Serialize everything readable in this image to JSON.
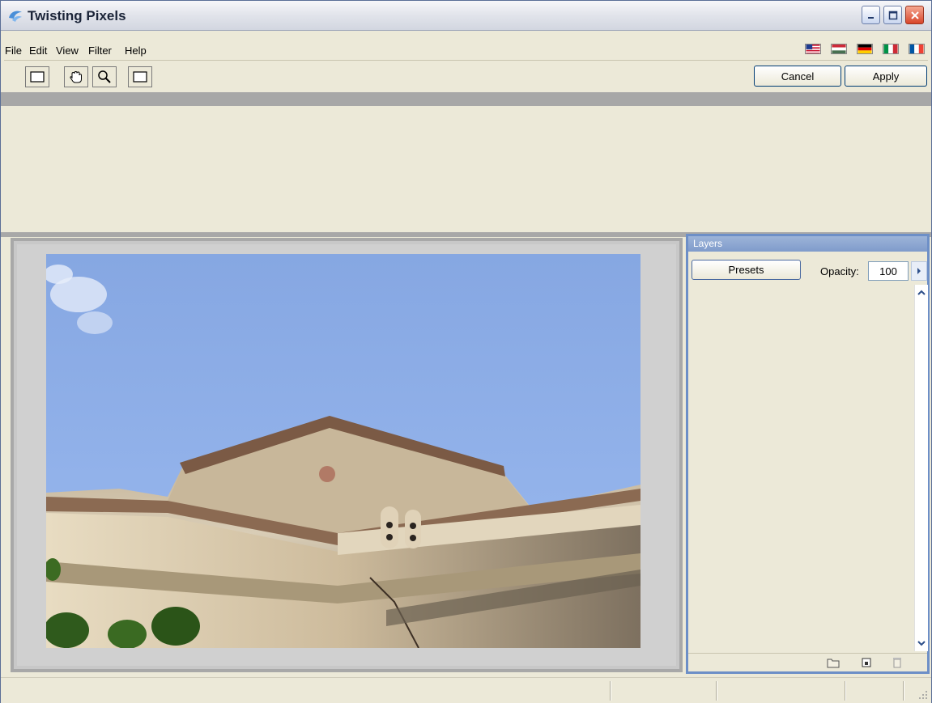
{
  "window": {
    "title": "Twisting Pixels",
    "controls": {
      "minimize": "minimize-icon",
      "maximize": "maximize-icon",
      "close": "close-icon"
    }
  },
  "menu": {
    "items": [
      "File",
      "Edit",
      "View",
      "Filter",
      "Help"
    ],
    "languages": [
      "us-flag-icon",
      "hungary-flag-icon",
      "germany-flag-icon",
      "italy-flag-icon",
      "france-flag-icon"
    ]
  },
  "toolbar": {
    "tools": [
      "select-rectangle-icon",
      "hand-pan-icon",
      "zoom-magnifier-icon",
      "fit-window-icon"
    ],
    "cancel_label": "Cancel",
    "apply_label": "Apply"
  },
  "layers": {
    "title": "Layers",
    "presets_label": "Presets",
    "opacity_label": "Opacity:",
    "opacity_value": "100",
    "footer_icons": [
      "new-layer-folder-icon",
      "duplicate-layer-icon",
      "delete-layer-icon"
    ]
  },
  "colors": {
    "accent": "#6d8fc7",
    "window_bg": "#ece9d8",
    "sky": "#8fb0e8"
  }
}
